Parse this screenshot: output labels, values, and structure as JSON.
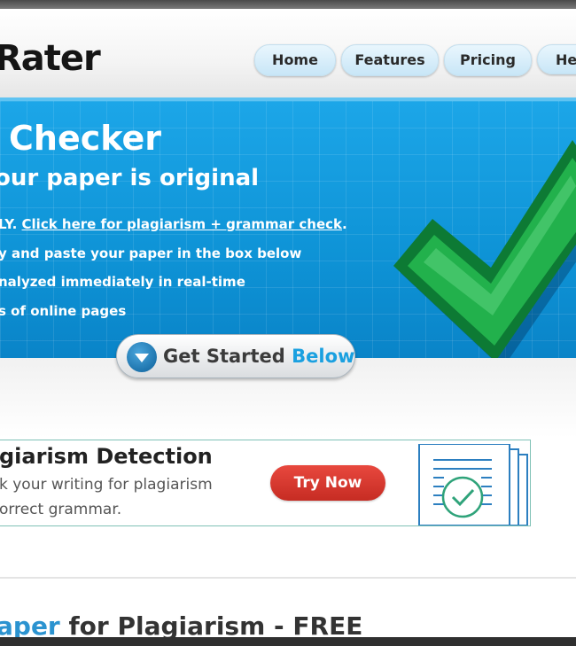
{
  "header": {
    "logo_text": "Rater",
    "nav": [
      {
        "label": "Home"
      },
      {
        "label": "Features"
      },
      {
        "label": "Pricing"
      },
      {
        "label": "He"
      }
    ]
  },
  "hero": {
    "title": "Checker",
    "subtitle": "our paper is original",
    "line1_prefix": "LY. ",
    "line1_link": "Click here for plagiarism + grammar check",
    "line1_suffix": ".",
    "line2": "y and paste your paper in the box below",
    "line3": "nalyzed immediately in real-time",
    "line4": "s of online pages",
    "cta_part1": "Get Started ",
    "cta_part2": "Below",
    "colors": {
      "hero_bg": "#0e93d6",
      "check_green": "#1aa844",
      "cta_blue": "#1aa0e0"
    }
  },
  "banner": {
    "title": "giarism Detection",
    "line1": "k your writing for plagiarism",
    "line2": "orrect grammar.",
    "button": "Try Now",
    "button_color": "#d9362c"
  },
  "section": {
    "title_blue": "aper",
    "title_rest": " for Plagiarism - FREE"
  }
}
